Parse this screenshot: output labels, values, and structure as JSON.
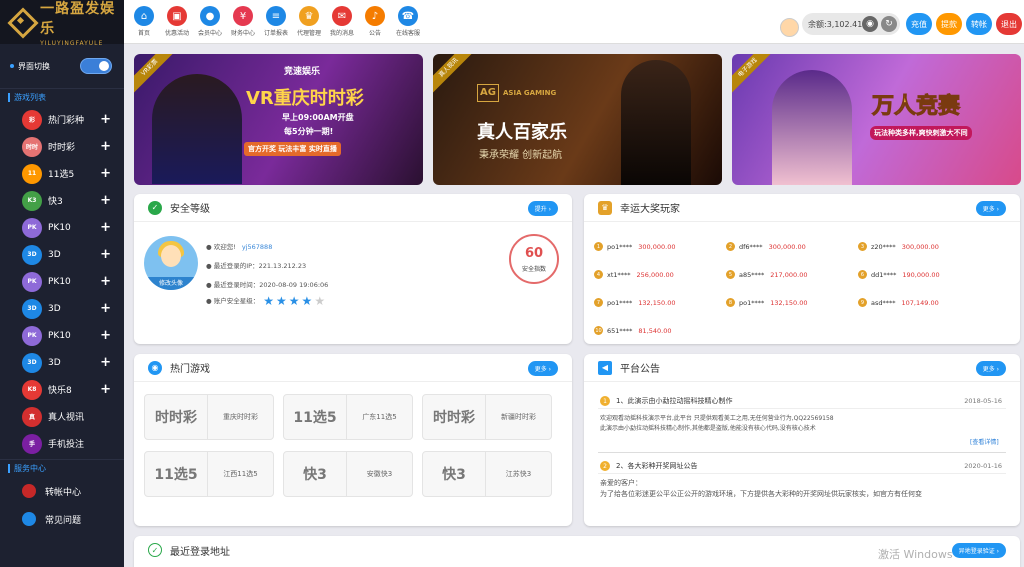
{
  "logo": {
    "cn": "一路盈发娱乐",
    "en": "YILUYINGFAYULE"
  },
  "sidebar": {
    "switch_label": "界面切换",
    "games_title": "游戏列表",
    "games": [
      {
        "label": "热门彩种",
        "icon": "hot-lottery-icon",
        "color": "#e53935",
        "text": "彩",
        "plus": "+"
      },
      {
        "label": "时时彩",
        "icon": "ssc-icon",
        "color": "#e57373",
        "text": "时时",
        "plus": "+"
      },
      {
        "label": "11选5",
        "icon": "11x5-icon",
        "color": "#ff9800",
        "text": "11",
        "plus": "+"
      },
      {
        "label": "快3",
        "icon": "k3-icon",
        "color": "#43a047",
        "text": "K3",
        "plus": "+"
      },
      {
        "label": "PK10",
        "icon": "pk10-icon",
        "color": "#8e6ad8",
        "text": "PK",
        "plus": "+"
      },
      {
        "label": "3D",
        "icon": "3d-icon",
        "color": "#1e88e5",
        "text": "3D",
        "plus": "+"
      },
      {
        "label": "PK10",
        "icon": "pk10-icon",
        "color": "#8e6ad8",
        "text": "PK",
        "plus": "+"
      },
      {
        "label": "3D",
        "icon": "3d-icon",
        "color": "#1e88e5",
        "text": "3D",
        "plus": "+"
      },
      {
        "label": "PK10",
        "icon": "pk10-icon",
        "color": "#8e6ad8",
        "text": "PK",
        "plus": "+"
      },
      {
        "label": "3D",
        "icon": "3d-icon",
        "color": "#1e88e5",
        "text": "3D",
        "plus": "+"
      },
      {
        "label": "快乐8",
        "icon": "kl8-icon",
        "color": "#e53935",
        "text": "K8",
        "plus": "+"
      },
      {
        "label": "真人视讯",
        "icon": "live-video-icon",
        "color": "#d32f2f",
        "text": "真",
        "plus": ""
      },
      {
        "label": "手机投注",
        "icon": "mobile-bet-icon",
        "color": "#7b1fa2",
        "text": "手",
        "plus": ""
      }
    ],
    "service_title": "服务中心",
    "service": [
      {
        "label": "转帐中心",
        "icon": "transfer-icon",
        "color": "#c62828"
      },
      {
        "label": "常见问题",
        "icon": "faq-icon",
        "color": "#1e88e5"
      }
    ]
  },
  "topnav": [
    {
      "label": "首页",
      "icon": "home-icon",
      "color": "#1e88e5",
      "glyph": "⌂"
    },
    {
      "label": "优惠活动",
      "icon": "gift-icon",
      "color": "#e53935",
      "glyph": "▣"
    },
    {
      "label": "会员中心",
      "icon": "user-icon",
      "color": "#1e88e5",
      "glyph": "●"
    },
    {
      "label": "财务中心",
      "icon": "finance-icon",
      "color": "#e53950",
      "glyph": "¥"
    },
    {
      "label": "订单报表",
      "icon": "report-icon",
      "color": "#1e88e5",
      "glyph": "≡"
    },
    {
      "label": "代理管理",
      "icon": "agent-icon",
      "color": "#f0a020",
      "glyph": "♛"
    },
    {
      "label": "我的消息",
      "icon": "message-icon",
      "color": "#e53935",
      "glyph": "✉"
    },
    {
      "label": "公告",
      "icon": "notice-icon",
      "color": "#f57c00",
      "glyph": "♪"
    },
    {
      "label": "在线客服",
      "icon": "support-icon",
      "color": "#1e88e5",
      "glyph": "☎"
    }
  ],
  "balance": {
    "label": "余额:3,102.41元"
  },
  "top_buttons": [
    {
      "label": "充值",
      "color": "#2196f3"
    },
    {
      "label": "提款",
      "color": "#ff9800"
    },
    {
      "label": "转帐",
      "color": "#2196f3"
    },
    {
      "label": "退出",
      "color": "#e53935"
    }
  ],
  "banners": [
    {
      "ribbon": "VR彩票",
      "brand": "竞速娱乐",
      "title": "VR重庆时时彩",
      "sub": "早上09:00AM开盘",
      "sub2": "每5分钟一期!",
      "tags": "官方开奖  玩法丰富  实时直播"
    },
    {
      "ribbon": "真人视讯",
      "brand": "ASIA GAMING",
      "title": "真人百家乐",
      "sub": "秉承荣耀  创新起航"
    },
    {
      "ribbon": "电子游戏",
      "title": "万人竞赛",
      "sub": "玩法种类多样,爽快刺激大不同"
    }
  ],
  "security": {
    "title": "安全等级",
    "btn": "提升 ›",
    "avatar_caption": "修改头像",
    "welcome_label": "欢迎您!",
    "username": "yj567888",
    "ip_line": "最近登录的IP：221.13.212.23",
    "time_line": "最近登录时间：2020-08-09 19:06:06",
    "level_label": "账户安全星级：",
    "stars": 4,
    "score": "60",
    "score_label": "安全指数"
  },
  "lucky": {
    "title": "幸运大奖玩家",
    "btn": "更多 ›",
    "players": [
      {
        "rank": "1",
        "name": "po1****",
        "amount": "300,000.00"
      },
      {
        "rank": "2",
        "name": "df6****",
        "amount": "300,000.00"
      },
      {
        "rank": "3",
        "name": "z20****",
        "amount": "300,000.00"
      },
      {
        "rank": "4",
        "name": "xt1****",
        "amount": "256,000.00"
      },
      {
        "rank": "5",
        "name": "a85****",
        "amount": "217,000.00"
      },
      {
        "rank": "6",
        "name": "dd1****",
        "amount": "190,000.00"
      },
      {
        "rank": "7",
        "name": "po1****",
        "amount": "132,150.00"
      },
      {
        "rank": "8",
        "name": "po1****",
        "amount": "132,150.00"
      },
      {
        "rank": "9",
        "name": "asd****",
        "amount": "107,149.00"
      },
      {
        "rank": "10",
        "name": "651****",
        "amount": "81,540.00"
      }
    ]
  },
  "hot": {
    "title": "热门游戏",
    "btn": "更多 ›",
    "games": [
      {
        "logo": "时时彩",
        "name": "重庆时时彩"
      },
      {
        "logo": "11选5",
        "name": "广东11选5"
      },
      {
        "logo": "时时彩",
        "name": "新疆时时彩"
      },
      {
        "logo": "11选5",
        "name": "江西11选5"
      },
      {
        "logo": "快3",
        "name": "安徽快3"
      },
      {
        "logo": "快3",
        "name": "江苏快3"
      }
    ]
  },
  "notice": {
    "title": "平台公告",
    "btn": "更多 ›",
    "items": [
      {
        "num": "1",
        "title": "1、此演示由小勐拉动摇科技精心制作",
        "date": "2018-05-16",
        "body1": "欢迎观看动摇科技演示平台,此平台 只提供观看美工之用,无任何营业行为,QQ22569158",
        "body2": "此演示由小勐拉动摇科技精心制作,其他都是盗版,他能没有核心代码,没有核心技术",
        "link": "[查看详情]"
      },
      {
        "num": "2",
        "title": "2、各大彩种开奖网址公告",
        "date": "2020-01-16",
        "body1": "亲爱的客户：",
        "body2": "为了给各位彩迷更公平公正公开的游戏环境，下方提供各大彩种的开奖网址供玩家核实，如官方有任何变"
      }
    ]
  },
  "recent": {
    "title": "最近登录地址",
    "btn": "异地登录验证 ›"
  },
  "watermark": "激活 Windows"
}
